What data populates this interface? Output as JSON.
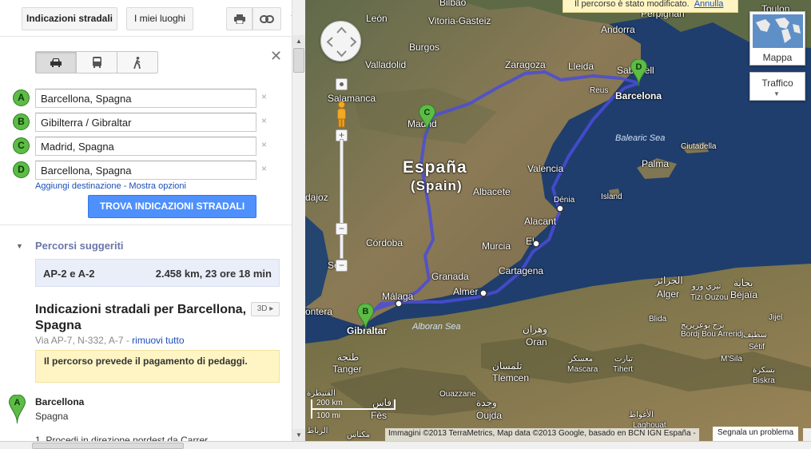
{
  "topbar": {
    "directions_label": "Indicazioni stradali",
    "places_label": "I miei luoghi"
  },
  "waypoints": [
    {
      "marker": "A",
      "value": "Barcellona, Spagna"
    },
    {
      "marker": "B",
      "value": "Gibilterra / Gibraltar"
    },
    {
      "marker": "C",
      "value": "Madrid, Spagna"
    },
    {
      "marker": "D",
      "value": "Barcellona, Spagna"
    }
  ],
  "remove_glyph": "×",
  "links": {
    "add_destination": "Aggiungi destinazione",
    "separator": " - ",
    "show_options": "Mostra opzioni"
  },
  "find_button": "TROVA INDICAZIONI STRADALI",
  "suggested": {
    "title": "Percorsi suggeriti",
    "route_name": "AP-2 e A-2",
    "route_stats": "2.458 km, 23 ore 18 min"
  },
  "directions": {
    "title": "Indicazioni stradali per Barcellona, Spagna",
    "btn_3d": "3D ▸",
    "via_text": "Via AP-7, N-332, A-7 - ",
    "via_remove": "rimuovi tutto",
    "toll_notice": "Il percorso prevede il pagamento di pedaggi.",
    "start_marker": "A",
    "start_city": "Barcellona",
    "start_country": "Spagna",
    "step1": "1. Procedi in direzione nordest da Carrer"
  },
  "map": {
    "notification": "Il percorso è stato modificato.",
    "notification_undo": "Annulla",
    "mappa_label": "Mappa",
    "traffico_label": "Traffico",
    "scale_km": "200 km",
    "scale_mi": "100 mi",
    "attribution": "Immagini ©2013 TerraMetrics, Map data ©2013 Google, basado en BCN IGN España -",
    "report_link": "Segnala un problema",
    "markers": [
      {
        "letter": "B",
        "city": "Gibraltar"
      },
      {
        "letter": "C",
        "city": "Madrid"
      },
      {
        "letter": "D",
        "city": "Barcelona"
      }
    ],
    "labels": {
      "leon": "León",
      "bilbao": "Bilbao",
      "vitoria": "Vitoria-Gasteiz",
      "andorra": "Andorra",
      "perpignan": "Perpignan",
      "toulon": "Toulon",
      "burgos": "Burgos",
      "valladolid": "Valladolid",
      "zaragoza": "Zaragoza",
      "lleida": "Lleida",
      "sabadell": "Sabadell",
      "reus": "Reus",
      "barcelona": "Barcelona",
      "salamanca": "Salamanca",
      "madrid": "Madrid",
      "balearic": "Balearic Sea",
      "ciutadella": "Ciutadella",
      "espana": "España",
      "spain": "(Spain)",
      "palma": "Palma",
      "valencia": "Valencia",
      "dajoz": "dajoz",
      "albacete": "Albacete",
      "denia": "Dénia",
      "island": "Island",
      "alacant": "Alacant",
      "cordoba": "Córdoba",
      "murcia": "Murcia",
      "elche": "El",
      "sevilla": "Se",
      "cartagena": "Cartagena",
      "granada": "Granada",
      "malaga": "Málaga",
      "almeria": "Almer",
      "ontera": "ontera",
      "gibraltar": "Gibraltar",
      "alboran": "Alboran Sea",
      "oran_ar": "وهران",
      "oran": "Oran",
      "tanger_ar": "طنجة",
      "tanger": "Tanger",
      "tlemcen_ar": "تلمسان",
      "tlemcen": "Tlemcen",
      "mascara_ar": "معسكر",
      "mascara": "Mascara",
      "tiaret_ar": "تيارت",
      "tiaret": "Tihert",
      "oujda_ar": "وجدة",
      "oujda": "Oujda",
      "fes_ar": "فاس",
      "fes": "Fès",
      "alger_ar": "الجزائر",
      "alger": "Alger",
      "tizi_ar": "تيزي وزو",
      "tizi": "Tizi Ouzou",
      "bejaia_ar": "بجاية",
      "bejaia": "Béjaïa",
      "blida": "Blida",
      "bordj": "Bordj Bou Arreridj",
      "bordj_ar": "برج بوعريريج",
      "setif_ar": "سطيف",
      "setif": "Sétif",
      "jijel": "Jijel",
      "msila": "M'Sila",
      "biskra_ar": "بسكرة",
      "biskra": "Biskra",
      "laghouat_ar": "الأغواط",
      "laghouat": "Laghouat",
      "kenitra_ar": "القنيطرة",
      "rabat_ar": "الرباط",
      "meknes_ar": "مكناس",
      "ouazzane": "Ouazzane"
    }
  }
}
